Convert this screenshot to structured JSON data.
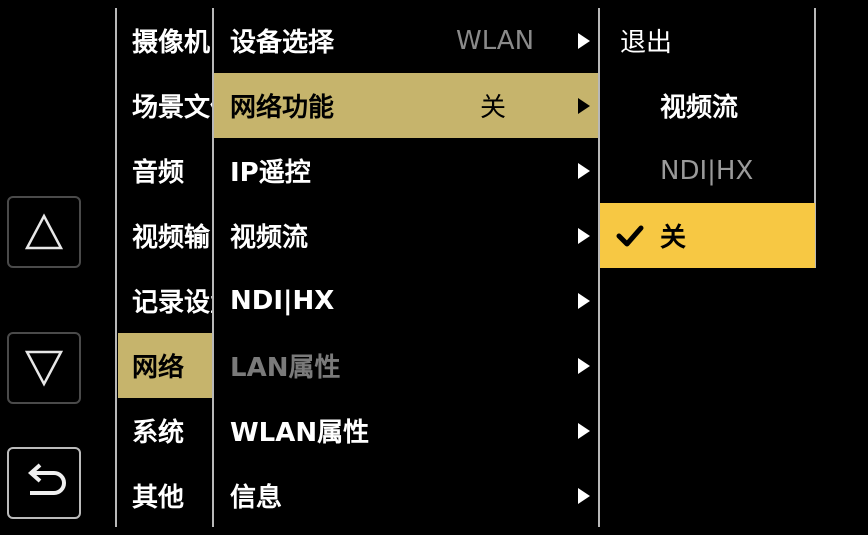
{
  "nav": {
    "up_icon": "triangle-up-icon",
    "down_icon": "triangle-down-icon",
    "back_icon": "return-arrow-icon"
  },
  "main_menu": {
    "items": [
      {
        "label": "摄像机"
      },
      {
        "label": "场景文件"
      },
      {
        "label": "音频"
      },
      {
        "label": "视频输出"
      },
      {
        "label": "记录设置"
      },
      {
        "label": "网络"
      },
      {
        "label": "系统"
      },
      {
        "label": "其他"
      }
    ],
    "active_index": 5
  },
  "sub_menu": {
    "items": [
      {
        "label": "设备选择",
        "value": "WLAN"
      },
      {
        "label": "网络功能",
        "value": "关"
      },
      {
        "label": "IP遥控",
        "value": ""
      },
      {
        "label": "视频流",
        "value": ""
      },
      {
        "label": "NDI|HX",
        "value": ""
      },
      {
        "label": "LAN属性",
        "value": ""
      },
      {
        "label": "WLAN属性",
        "value": ""
      },
      {
        "label": "信息",
        "value": ""
      }
    ],
    "active_index": 1,
    "disabled_index": 5
  },
  "options_panel": {
    "exit_label": "退出",
    "heading": "视频流",
    "option_ndi": "NDI|HX",
    "option_off": "关",
    "check_icon": "checkmark-icon"
  },
  "colors": {
    "background": "#000000",
    "highlight": "#c6b46c",
    "selected": "#f7c843",
    "disabled_text": "#7a7a7a"
  }
}
